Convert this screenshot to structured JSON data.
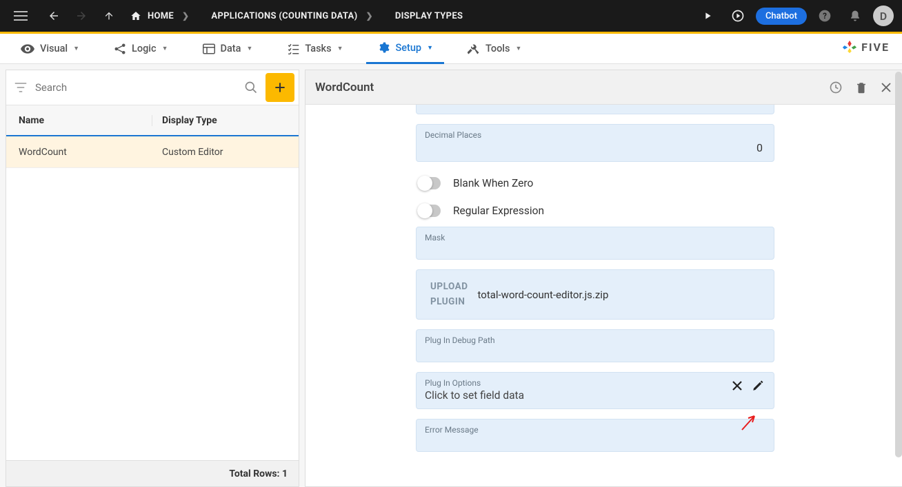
{
  "topbar": {
    "home": "HOME",
    "crumb2": "APPLICATIONS (COUNTING DATA)",
    "crumb3": "DISPLAY TYPES",
    "chatbot": "Chatbot",
    "avatar": "D"
  },
  "tabs": {
    "visual": "Visual",
    "logic": "Logic",
    "data": "Data",
    "tasks": "Tasks",
    "setup": "Setup",
    "tools": "Tools"
  },
  "brand": "FIVE",
  "leftpanel": {
    "search_placeholder": "Search",
    "hdr_name": "Name",
    "hdr_type": "Display Type",
    "row_name": "WordCount",
    "row_type": "Custom Editor",
    "footer": "Total Rows: 1"
  },
  "rightpanel": {
    "title": "WordCount",
    "fields": {
      "decimal_label": "Decimal Places",
      "decimal_value": "0",
      "blank_when_zero": "Blank When Zero",
      "regex": "Regular Expression",
      "mask_label": "Mask",
      "upload_label1": "UPLOAD",
      "upload_label2": "PLUGIN",
      "upload_file": "total-word-count-editor.js.zip",
      "debug_label": "Plug In Debug Path",
      "options_label": "Plug In Options",
      "options_value": "Click to set field data",
      "error_label": "Error Message"
    }
  }
}
